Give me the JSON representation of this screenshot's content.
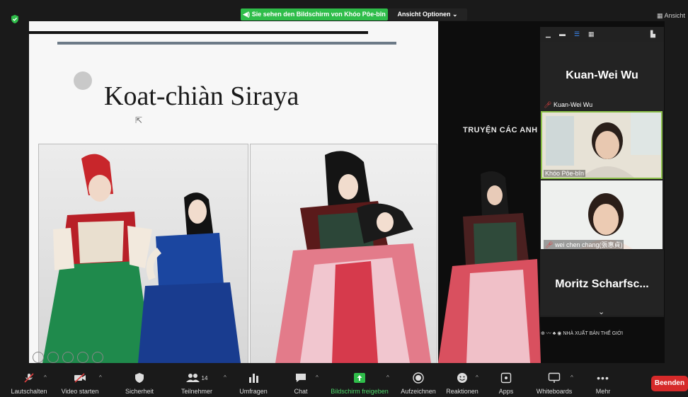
{
  "top": {
    "share_banner": "Sie sehen den Bildschirm von Khóo Pôe-bîn",
    "view_options": "Ansicht Optionen",
    "ansicht_corner": "Ansicht"
  },
  "slide": {
    "title": "Koat-chiàn Siraya"
  },
  "book": {
    "title": "TRUYỆN CÁC ANH HÙN",
    "publisher": "NHÀ XUẤT BẢN THẾ GIỚI"
  },
  "participants": [
    {
      "name": "Kuan-Wei Wu",
      "label": "Kuan-Wei Wu",
      "muted": true
    },
    {
      "name": "Khóo Pôe-bîn",
      "label": "Khóo Pôe-bîn",
      "muted": false,
      "active_speaker": true
    },
    {
      "name": "wei chen chang(張惠貞)",
      "label": "wei chen chang(張惠貞)",
      "muted": true
    },
    {
      "name": "Moritz Scharfsc...",
      "label": "Moritz Scharfsc...",
      "muted": false
    }
  ],
  "toolbar": {
    "items": [
      {
        "label": "Lautschalten",
        "icon": "microphone-muted-icon"
      },
      {
        "label": "Video starten",
        "icon": "video-off-icon"
      },
      {
        "label": "Sicherheit",
        "icon": "shield-icon"
      },
      {
        "label": "Teilnehmer",
        "icon": "participants-icon",
        "count": "14"
      },
      {
        "label": "Umfragen",
        "icon": "polls-icon"
      },
      {
        "label": "Chat",
        "icon": "chat-icon"
      },
      {
        "label": "Bildschirm freigeben",
        "icon": "share-screen-icon"
      },
      {
        "label": "Aufzeichnen",
        "icon": "record-icon"
      },
      {
        "label": "Reaktionen",
        "icon": "reactions-icon"
      },
      {
        "label": "Apps",
        "icon": "apps-icon"
      },
      {
        "label": "Whiteboards",
        "icon": "whiteboard-icon"
      },
      {
        "label": "Mehr",
        "icon": "more-icon"
      }
    ],
    "end_label": "Beenden"
  },
  "colors": {
    "share_green": "#2fbd4a",
    "end_red": "#d62a2a",
    "active_speaker_border": "#8cc04a"
  }
}
